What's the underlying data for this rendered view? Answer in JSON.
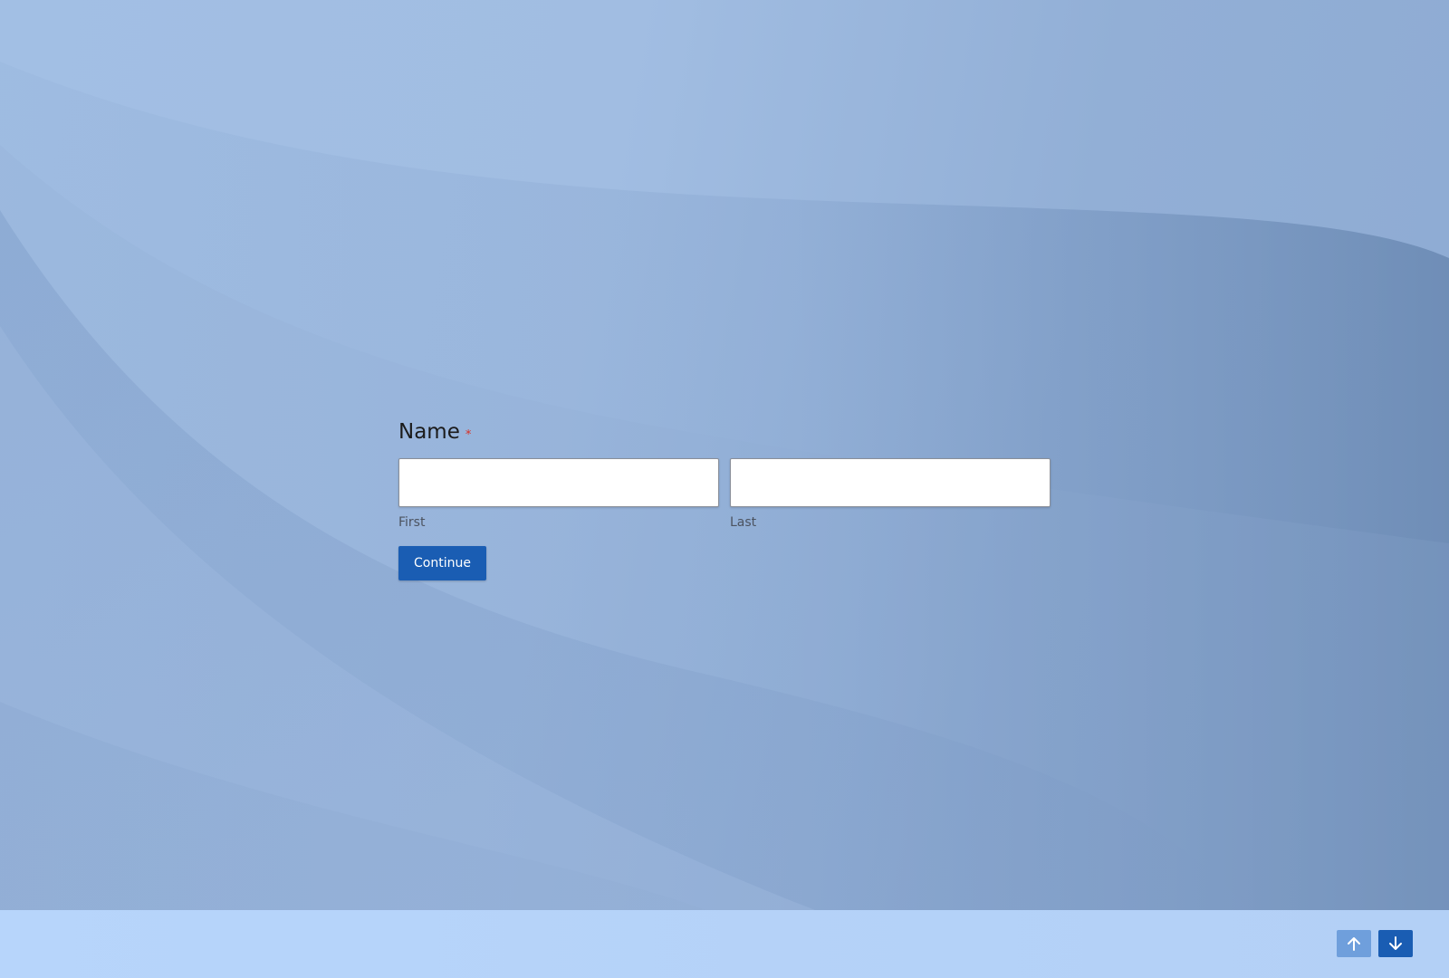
{
  "form": {
    "field_label": "Name",
    "required_mark": "*",
    "first": {
      "value": "",
      "placeholder": "",
      "sublabel": "First"
    },
    "last": {
      "value": "",
      "placeholder": "",
      "sublabel": "Last"
    },
    "continue_label": "Continue"
  },
  "navigation": {
    "prev_icon": "arrow-up-icon",
    "next_icon": "arrow-down-icon"
  },
  "colors": {
    "accent": "#1a5db3",
    "nav_prev_bg": "#6f9fdc",
    "required": "#d93025",
    "background": "#a1bde2",
    "footer": "#b5d2f8"
  }
}
